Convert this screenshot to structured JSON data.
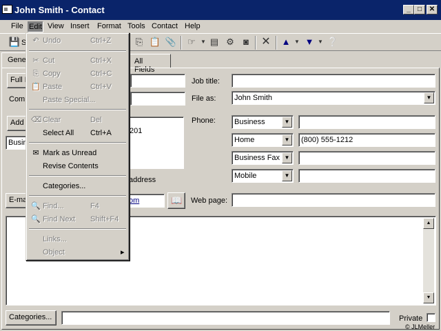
{
  "window": {
    "title": "John Smith - Contact",
    "min": "_",
    "max": "□",
    "close": "✕"
  },
  "menubar": {
    "items": [
      {
        "label": "File"
      },
      {
        "label": "Edit"
      },
      {
        "label": "View"
      },
      {
        "label": "Insert"
      },
      {
        "label": "Format"
      },
      {
        "label": "Tools"
      },
      {
        "label": "Contact"
      },
      {
        "label": "Help"
      }
    ]
  },
  "toolbar": {
    "save_label": "S"
  },
  "tabs": [
    {
      "label": "Gene"
    },
    {
      "label": "All Fields"
    }
  ],
  "edit_menu": {
    "items": [
      {
        "label": "Undo",
        "shortcut": "Ctrl+Z",
        "icon": "↶"
      },
      {
        "label": "Cut",
        "shortcut": "Ctrl+X",
        "icon": "✂"
      },
      {
        "label": "Copy",
        "shortcut": "Ctrl+C",
        "icon": "⎘"
      },
      {
        "label": "Paste",
        "shortcut": "Ctrl+V",
        "icon": "📋"
      },
      {
        "label": "Paste Special..."
      },
      {
        "label": "Clear",
        "shortcut": "Del",
        "icon": "⌫"
      },
      {
        "label": "Select All",
        "shortcut": "Ctrl+A"
      },
      {
        "label": "Mark as Unread",
        "icon": "✉"
      },
      {
        "label": "Revise Contents"
      },
      {
        "label": "Categories..."
      },
      {
        "label": "Find...",
        "shortcut": "F4",
        "icon": "🔍"
      },
      {
        "label": "Find Next",
        "shortcut": "Shift+F4",
        "icon": "🔍"
      },
      {
        "label": "Links..."
      },
      {
        "label": "Object",
        "submenu_arrow": "▸"
      }
    ]
  },
  "form": {
    "full_name_button": "Full N",
    "company_label": "Comp",
    "address_button": "Add",
    "address_type": "Busin",
    "address_text": "201",
    "mailing_address_text": "address",
    "email_button": "E-mai",
    "email_value_tail": "om",
    "job_title_label": "Job title:",
    "job_title_value": "",
    "file_as_label": "File as:",
    "file_as_value": "John Smith",
    "phone_label": "Phone:",
    "phones": [
      {
        "type": "Business",
        "value": ""
      },
      {
        "type": "Home",
        "value": "(800) 555-1212"
      },
      {
        "type": "Business Fax",
        "value": ""
      },
      {
        "type": "Mobile",
        "value": ""
      }
    ],
    "web_page_label": "Web page:",
    "web_page_value": "",
    "categories_button": "Categories...",
    "categories_value": "",
    "private_label": "Private",
    "copyright": "© JLMeller"
  }
}
